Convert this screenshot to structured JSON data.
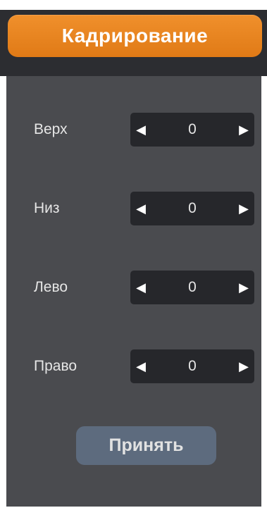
{
  "header": {
    "title": "Кадрирование"
  },
  "crop": {
    "rows": [
      {
        "label": "Верх",
        "value": "0",
        "left_arrow": "◀",
        "right_arrow": "▶"
      },
      {
        "label": "Низ",
        "value": "0",
        "left_arrow": "◀",
        "right_arrow": "▶"
      },
      {
        "label": "Лево",
        "value": "0",
        "left_arrow": "◀",
        "right_arrow": "▶"
      },
      {
        "label": "Право",
        "value": "0",
        "left_arrow": "◀",
        "right_arrow": "▶"
      }
    ]
  },
  "actions": {
    "accept_label": "Принять"
  },
  "colors": {
    "title_bg": "#e8861f",
    "panel_bg": "#4a4b4f",
    "header_bg": "#2c2d31",
    "stepper_bg": "#26272b",
    "accept_bg": "#5d6b7e"
  }
}
